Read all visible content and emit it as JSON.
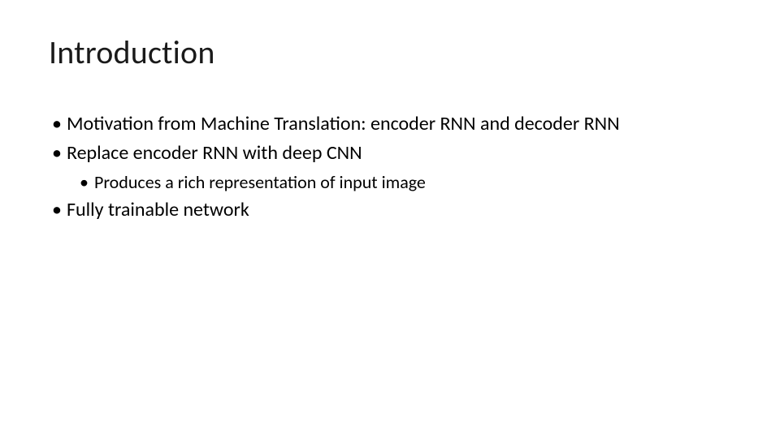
{
  "slide": {
    "title": "Introduction",
    "bullets": {
      "item1": "Motivation from Machine Translation: encoder RNN and decoder RNN",
      "item2": "Replace encoder RNN with deep CNN",
      "item2_sub1": "Produces a rich representation of input image",
      "item3": "Fully trainable network"
    }
  }
}
